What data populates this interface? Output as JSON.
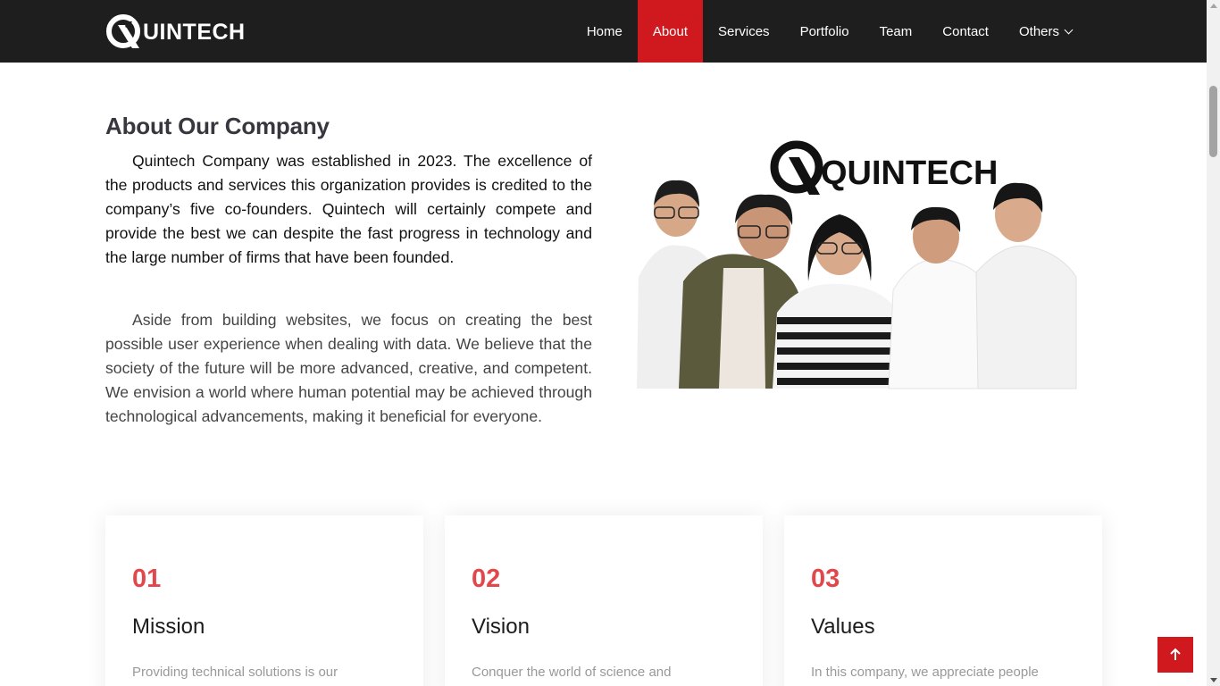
{
  "brand": {
    "name": "QUINTECH",
    "rest": "UINTECH"
  },
  "nav": {
    "items": [
      {
        "label": "Home"
      },
      {
        "label": "About"
      },
      {
        "label": "Services"
      },
      {
        "label": "Portfolio"
      },
      {
        "label": "Team"
      },
      {
        "label": "Contact"
      },
      {
        "label": "Others"
      }
    ],
    "active": "About"
  },
  "about": {
    "title": "About Our Company",
    "p1": "Quintech Company was established in 2023. The excellence of the products and services this organization provides is credited to the company’s five co-founders. Quintech will certainly compete and provide the best we can despite the fast progress in technology and the large number of firms that have been founded.",
    "p2": "Aside from building websites, we focus on creating the best possible user experience when dealing with data. We believe that the society of the future will be more advanced, creative, and competent. We envision a world where human potential may be achieved through technological advancements, making it beneficial for everyone.",
    "image_logo": "QUINTECH"
  },
  "cards": [
    {
      "num": "01",
      "title": "Mission",
      "text": "Providing technical solutions is our"
    },
    {
      "num": "02",
      "title": "Vision",
      "text": "Conquer the world of science and"
    },
    {
      "num": "03",
      "title": "Values",
      "text": "In this company, we appreciate people"
    }
  ],
  "colors": {
    "accent": "#d0181f",
    "header": "#1e1e1e",
    "number": "#e2474b"
  },
  "icons": {
    "back_to_top": "arrow-up-icon",
    "others_dropdown": "chevron-down-icon"
  }
}
